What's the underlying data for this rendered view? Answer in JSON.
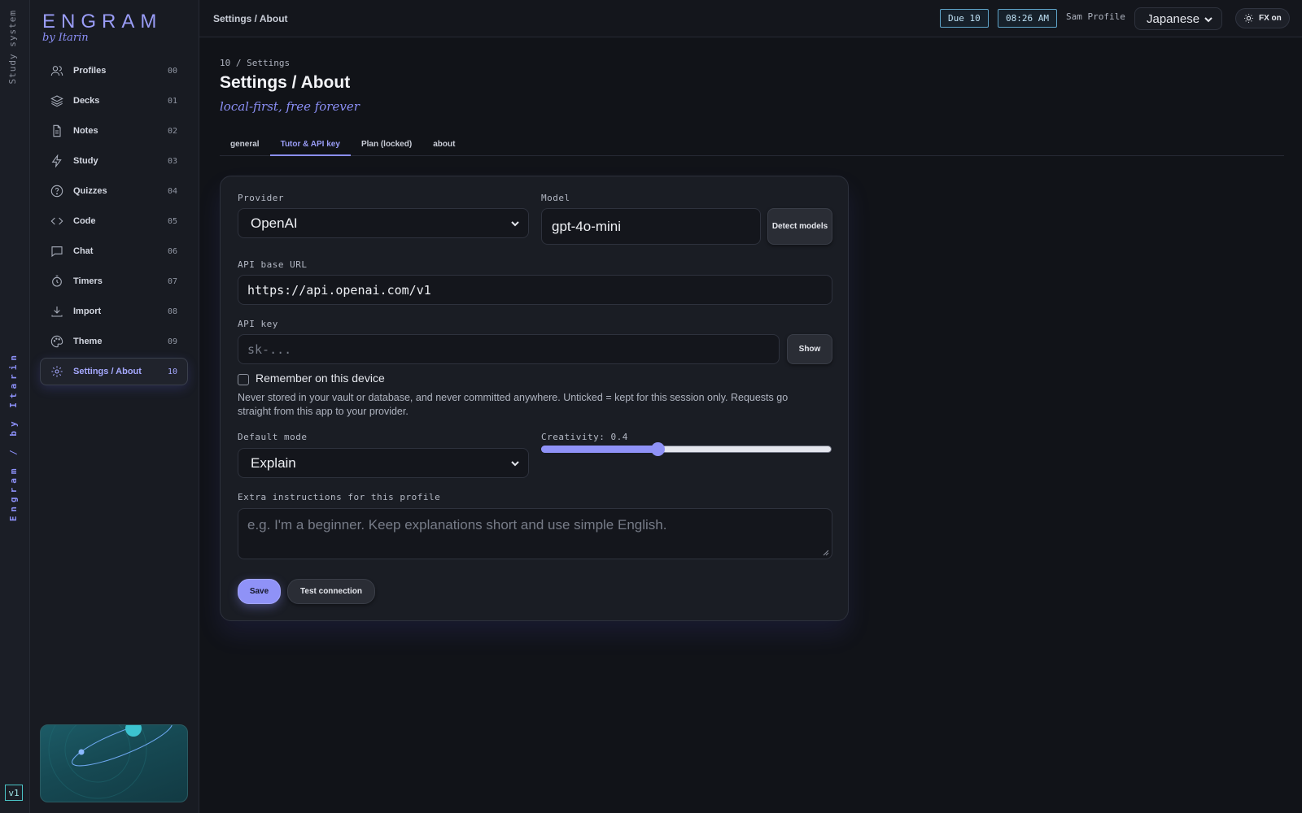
{
  "rail": {
    "top_label": "Study system",
    "mid_label": "Engram / by Itarin",
    "version": "v1"
  },
  "brand": {
    "name": "ENGRAM",
    "byline": "by Itarin"
  },
  "nav": [
    {
      "label": "Profiles",
      "num": "00",
      "icon": "users-icon"
    },
    {
      "label": "Decks",
      "num": "01",
      "icon": "layers-icon"
    },
    {
      "label": "Notes",
      "num": "02",
      "icon": "file-text-icon"
    },
    {
      "label": "Study",
      "num": "03",
      "icon": "lightning-icon"
    },
    {
      "label": "Quizzes",
      "num": "04",
      "icon": "help-circle-icon"
    },
    {
      "label": "Code",
      "num": "05",
      "icon": "code-icon"
    },
    {
      "label": "Chat",
      "num": "06",
      "icon": "chat-icon"
    },
    {
      "label": "Timers",
      "num": "07",
      "icon": "timer-icon"
    },
    {
      "label": "Import",
      "num": "08",
      "icon": "download-icon"
    },
    {
      "label": "Theme",
      "num": "09",
      "icon": "palette-icon"
    },
    {
      "label": "Settings / About",
      "num": "10",
      "icon": "gear-icon",
      "active": true
    }
  ],
  "topbar": {
    "breadcrumb": "Settings / About",
    "due": "Due 10",
    "time": "08:26 AM",
    "user": "Sam Profile",
    "language": "Japanese",
    "fx": "FX on"
  },
  "page": {
    "eyebrow": "10 / Settings",
    "title": "Settings / About",
    "tagline": "local-first, free forever",
    "tabs": [
      {
        "label": "general"
      },
      {
        "label": "Tutor & API key",
        "active": true
      },
      {
        "label": "Plan (locked)"
      },
      {
        "label": "about"
      }
    ]
  },
  "form": {
    "provider_label": "Provider",
    "provider_value": "OpenAI",
    "model_label": "Model",
    "model_value": "gpt-4o-mini",
    "detect_button": "Detect models",
    "base_url_label": "API base URL",
    "base_url_value": "https://api.openai.com/v1",
    "api_key_label": "API key",
    "api_key_placeholder": "sk-...",
    "show_button": "Show",
    "remember_label": "Remember on this device",
    "remember_checked": false,
    "note": "Never stored in your vault or database, and never committed anywhere. Unticked = kept for this session only. Requests go straight from this app to your provider.",
    "mode_label": "Default mode",
    "mode_value": "Explain",
    "creativity_label": "Creativity: 0.4",
    "creativity_value": 0.4,
    "extra_label": "Extra instructions for this profile",
    "extra_placeholder": "e.g. I'm a beginner. Keep explanations short and use simple English.",
    "save_button": "Save",
    "test_button": "Test connection"
  },
  "colors": {
    "accent": "#8f92f7",
    "teal": "#4bc4c7",
    "bg": "#111318"
  }
}
